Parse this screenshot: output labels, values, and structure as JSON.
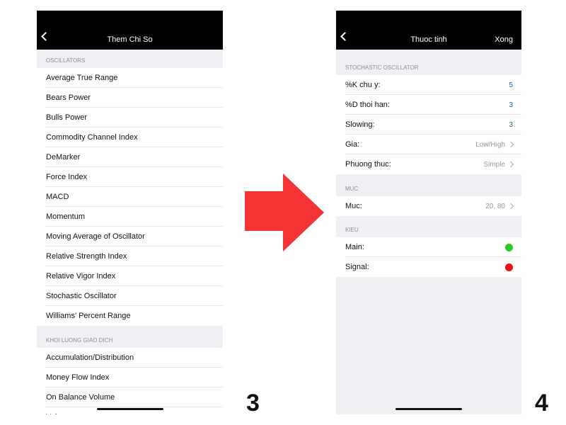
{
  "screen3": {
    "title": "Them Chi So",
    "sections": [
      {
        "header": "OSCILLATORS",
        "items": [
          "Average True Range",
          "Bears Power",
          "Bulls Power",
          "Commodity Channel Index",
          "DeMarker",
          "Force Index",
          "MACD",
          "Momentum",
          "Moving Average of Oscillator",
          "Relative Strength Index",
          "Relative Vigor Index",
          "Stochastic Oscillator",
          "Williams' Percent Range"
        ]
      },
      {
        "header": "KHOI LUONG GIAO DICH",
        "items": [
          "Accumulation/Distribution",
          "Money Flow Index",
          "On Balance Volume",
          "Volumes"
        ]
      }
    ],
    "step": "3"
  },
  "screen4": {
    "title": "Thuoc tinh",
    "done": "Xong",
    "stoch_header": "STOCHASTIC OSCILLATOR",
    "stoch_rows": [
      {
        "label": "%K chu y:",
        "value": "5"
      },
      {
        "label": "%D thoi han:",
        "value": "3"
      },
      {
        "label": "Slowing:",
        "value": "3"
      },
      {
        "label": "Gia:",
        "value": "Low/High"
      },
      {
        "label": "Phuong thuc:",
        "value": "Simple"
      }
    ],
    "muc_header": "MUC",
    "muc_row": {
      "label": "Muc:",
      "value": "20, 80"
    },
    "kieu_header": "KIEU",
    "kieu_rows": [
      {
        "label": "Main:",
        "color": "#22cc22"
      },
      {
        "label": "Signal:",
        "color": "#ee1111"
      }
    ],
    "step": "4"
  },
  "arrow_color": "#f43434"
}
